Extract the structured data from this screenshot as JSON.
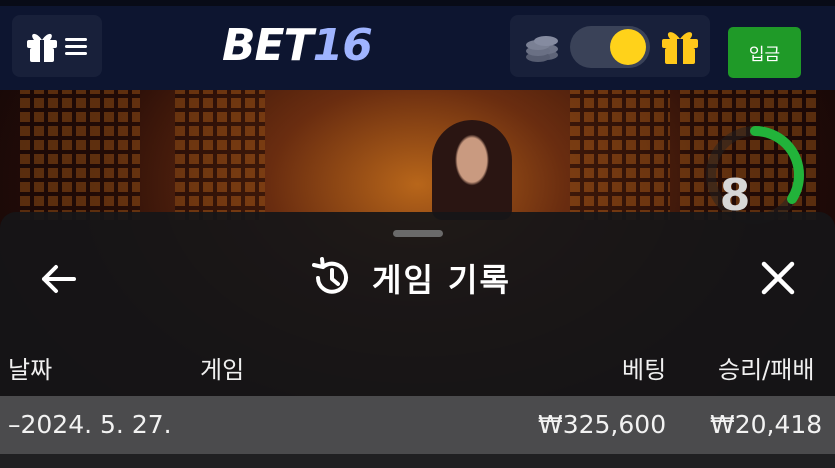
{
  "header": {
    "logo_part1": "BET",
    "logo_part2": "16",
    "deposit_label": "입금",
    "theme_toggle_state": "on"
  },
  "video": {
    "countdown": "8"
  },
  "history": {
    "title": "게임 기록",
    "columns": {
      "date": "날짜",
      "game": "게임",
      "bet": "베팅",
      "win_loss": "승리/패배"
    },
    "rows": [
      {
        "date": "–2024. 5. 27.",
        "game": "",
        "bet": "₩325,600",
        "win_loss": "₩20,418"
      }
    ]
  },
  "colors": {
    "header_bg": "#0d1530",
    "deposit_green": "#1f9a28",
    "toggle_knob": "#ffd21a",
    "sheet_bg": "#161618",
    "row_bg": "#4b4b4d",
    "timer_green": "#22b33a"
  }
}
